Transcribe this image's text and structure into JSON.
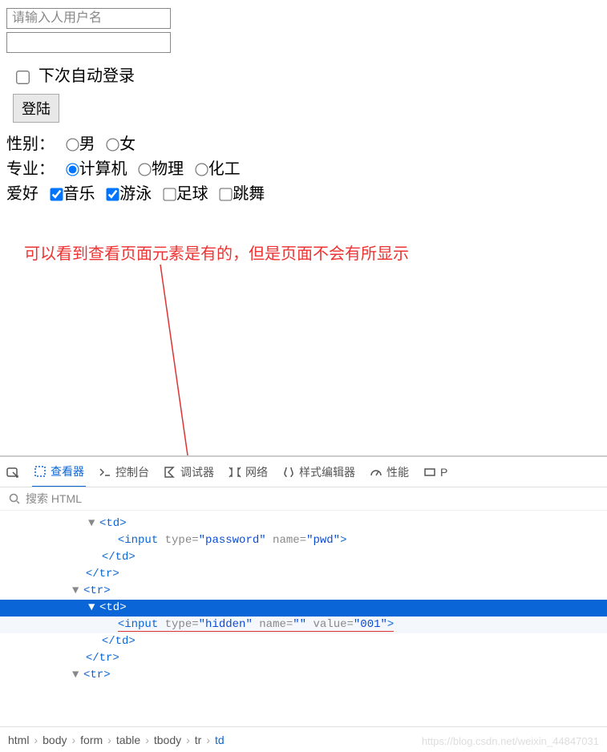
{
  "form": {
    "username_placeholder": "请输入人用户名",
    "auto_login_label": "下次自动登录",
    "login_button": "登陆",
    "gender_label": "性别：",
    "male": "男",
    "female": "女",
    "major_label": "专业：",
    "major_cs": "计算机",
    "major_phys": "物理",
    "major_chem": "化工",
    "hobby_label": "爱好",
    "hobby_music": "音乐",
    "hobby_swim": "游泳",
    "hobby_football": "足球",
    "hobby_dance": "跳舞"
  },
  "annotation": "可以看到查看页面元素是有的，但是页面不会有所显示",
  "devtools": {
    "tabs": {
      "inspector": "查看器",
      "console": "控制台",
      "debugger": "调试器",
      "network": "网络",
      "style": "样式编辑器",
      "perf": "性能",
      "more": "P"
    },
    "search_placeholder": "搜索 HTML",
    "dom": {
      "td_open": "<td>",
      "input_pwd_open": "<input ",
      "type_label": "type=",
      "type_pwd": "\"password\"",
      "name_label": " name=",
      "name_pwd": "\"pwd\"",
      "close_tag": ">",
      "td_close": "</td>",
      "tr_close": "</tr>",
      "tr_open": "<tr>",
      "input_hidden_open": "<input ",
      "type_hidden": "\"hidden\"",
      "name_empty": "\"\"",
      "value_label": " value=",
      "value_001": "\"001\""
    },
    "breadcrumb": [
      "html",
      "body",
      "form",
      "table",
      "tbody",
      "tr",
      "td"
    ]
  },
  "watermark": "https://blog.csdn.net/weixin_44847031"
}
